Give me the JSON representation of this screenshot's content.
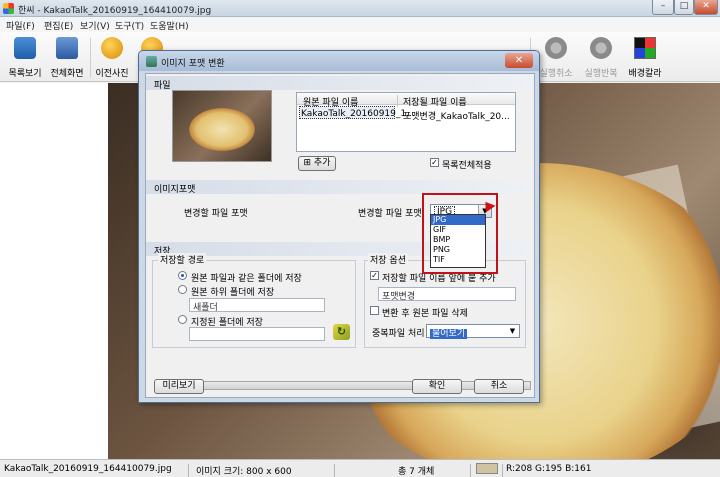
{
  "window": {
    "title": "한씨 - KakaoTalk_20160919_164410079.jpg",
    "controls": {
      "minimize": "–",
      "maximize": "□",
      "close": "✕"
    }
  },
  "menu": [
    "파일(F)",
    "편집(E)",
    "보기(V)",
    "도구(T)",
    "도움말(H)"
  ],
  "toolbar": {
    "list_view": "목록보기",
    "fullscreen": "전체화면",
    "prev_photo": "이전사진",
    "undo": "실행취소",
    "redo": "실행반복",
    "bg_color": "배경칼라"
  },
  "dialog": {
    "title": "이미지 포맷 변환",
    "close": "✕",
    "file_section": "파일",
    "table": {
      "headers": [
        "원본 파일 이름",
        "저장될 파일 이름"
      ],
      "rows": [
        [
          "KakaoTalk_20160919_1...",
          "포맷변경_KakaoTalk_20..."
        ]
      ]
    },
    "add_button": "추가",
    "apply_all_label": "목록전체적용",
    "apply_all_checked": true,
    "format_section": "이미지포맷",
    "format_label_left": "변경할 파일 포맷",
    "format_label_right": "변경할 파일 포맷",
    "format_selected": "JPG",
    "format_options": [
      "JPG",
      "GIF",
      "BMP",
      "PNG",
      "TIF"
    ],
    "save_section": "저장",
    "save_path_group": "저장할 경로",
    "save_path_options": [
      "원본 파일과 같은 폴더에 저장",
      "원본 하위 폴더에 저장",
      "지정된 폴더에 저장"
    ],
    "subfolder_placeholder": "새폴더",
    "save_options_group": "저장 옵션",
    "add_prefix_label": "저장할 파일 이름 앞에 붙 추가",
    "add_prefix_checked": true,
    "prefix_value": "포맷변경_",
    "delete_original_label": "변환 후 원본 파일 삭제",
    "delete_original_checked": false,
    "duplicate_label": "중복파일 처리",
    "duplicate_value": "물어보기",
    "preview_button": "미리보기",
    "ok_button": "확인",
    "cancel_button": "취소"
  },
  "status": {
    "filename": "KakaoTalk_20160919_164410079.jpg",
    "image_size": "이미지 크기: 800 x 600",
    "count": "총 7 개체",
    "rgb": "R:208 G:195 B:161",
    "swatch_color": "#d0c3a1"
  }
}
